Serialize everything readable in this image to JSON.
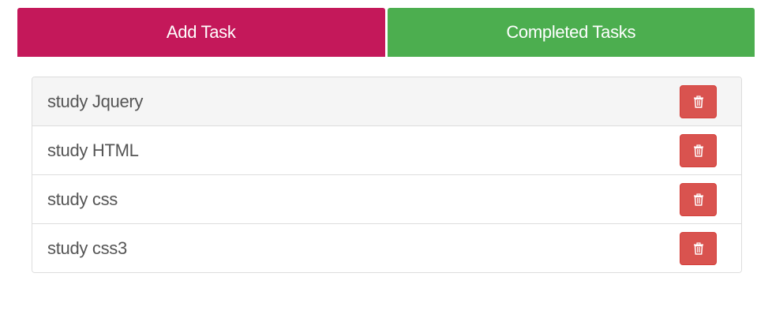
{
  "tabs": {
    "add_label": "Add Task",
    "completed_label": "Completed Tasks"
  },
  "colors": {
    "add_tab": "#c4185a",
    "completed_tab": "#4cae4f",
    "delete_button": "#d9534f"
  },
  "tasks": [
    {
      "label": "study Jquery",
      "delete_icon": "trash-icon"
    },
    {
      "label": "study HTML",
      "delete_icon": "trash-icon"
    },
    {
      "label": "study css",
      "delete_icon": "trash-icon"
    },
    {
      "label": "study css3",
      "delete_icon": "trash-icon"
    }
  ]
}
